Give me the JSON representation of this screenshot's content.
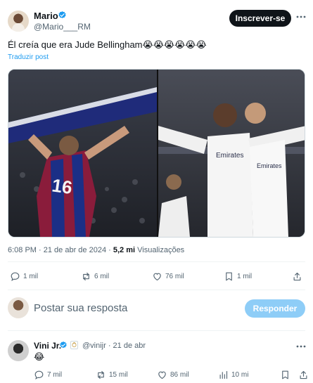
{
  "post": {
    "author": "Mario",
    "handle": "@Mario___RM",
    "subscribe_label": "Inscrever-se",
    "text": "Él creía que era Jude Bellingham😭😭😭😭😭😭",
    "translate_label": "Traduzir post",
    "time": "6:08 PM",
    "date": "21 de abr de 2024",
    "views_count": "5,2 mi",
    "views_label": "Visualizações",
    "actions": {
      "replies": "1 mil",
      "reposts": "6 mil",
      "likes": "76 mil",
      "bookmarks": "1 mil"
    },
    "media": {
      "left_icon": "image-player-gesturing",
      "right_icon": "image-players-celebrating"
    }
  },
  "reply_box": {
    "placeholder": "Postar sua resposta",
    "button_label": "Responder"
  },
  "reply": {
    "author": "Vini Jr.",
    "handle": "@vinijr · 21 de abr",
    "text": "😂",
    "actions": {
      "replies": "7 mil",
      "reposts": "15 mil",
      "likes": "86 mil",
      "views": "10 mi"
    }
  },
  "colors": {
    "accent": "#1d9bf0",
    "text_primary": "#0f1419",
    "text_secondary": "#536471",
    "reply_button": "#8ecdf7"
  }
}
